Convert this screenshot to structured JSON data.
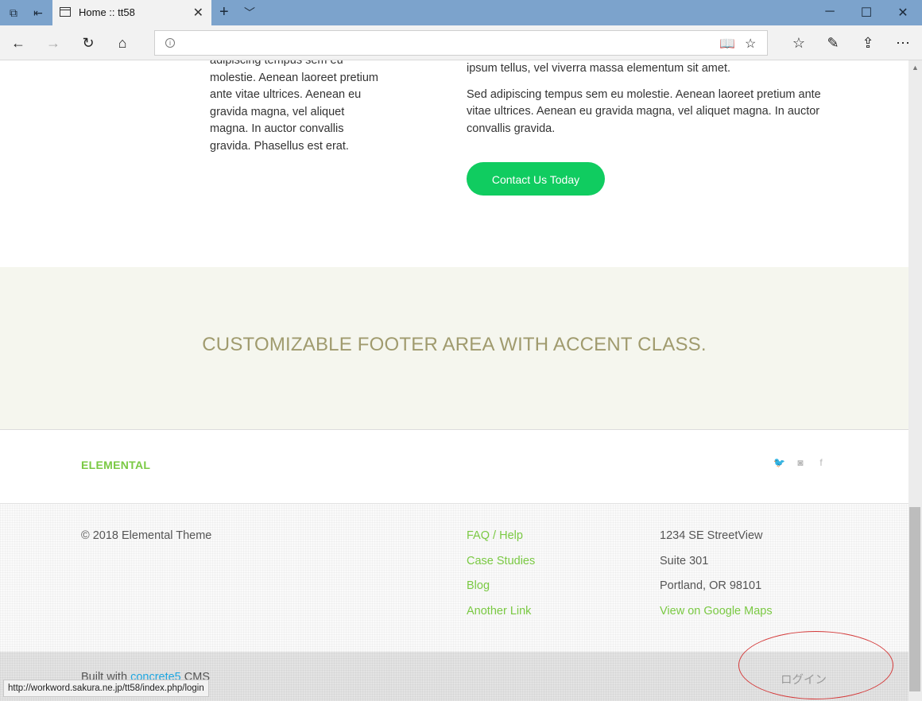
{
  "browser": {
    "tab_title": "Home :: tt58",
    "address_value": "",
    "status_url": "http://workword.sakura.ne.jp/tt58/index.php/login"
  },
  "content": {
    "left_text": "adipiscing tempus sem eu molestie. Aenean laoreet pretium ante vitae ultrices. Aenean eu gravida magna, vel aliquet magna. In auctor convallis gravida. Phasellus est erat.",
    "right_p1": "ipsum tellus, vel viverra massa elementum sit amet.",
    "right_p2": "Sed adipiscing tempus sem eu molestie. Aenean laoreet pretium ante vitae ultrices. Aenean eu gravida magna, vel aliquet magna. In auctor convallis gravida.",
    "cta_label": "Contact Us Today"
  },
  "accent": {
    "heading": "CUSTOMIZABLE FOOTER AREA WITH ACCENT CLASS."
  },
  "brand": {
    "logo": "ELEMENTAL",
    "social": [
      "twitter-icon",
      "instagram-icon",
      "facebook-icon"
    ]
  },
  "footer": {
    "copyright": "© 2018 Elemental Theme",
    "links": [
      "FAQ / Help",
      "Case Studies",
      "Blog",
      "Another Link"
    ],
    "address": [
      "1234 SE StreetView",
      "Suite 301",
      "Portland, OR 98101"
    ],
    "map_link": "View on Google Maps"
  },
  "bottom": {
    "built_prefix": "Built with ",
    "built_link": "concrete5",
    "built_suffix": " CMS",
    "login": "ログイン"
  },
  "colors": {
    "accent_green": "#7ac943",
    "cta_green": "#10cc60",
    "titlebar": "#7ca3cc",
    "accent_text": "#a09b6e",
    "annotation_red": "#d43a3a"
  }
}
